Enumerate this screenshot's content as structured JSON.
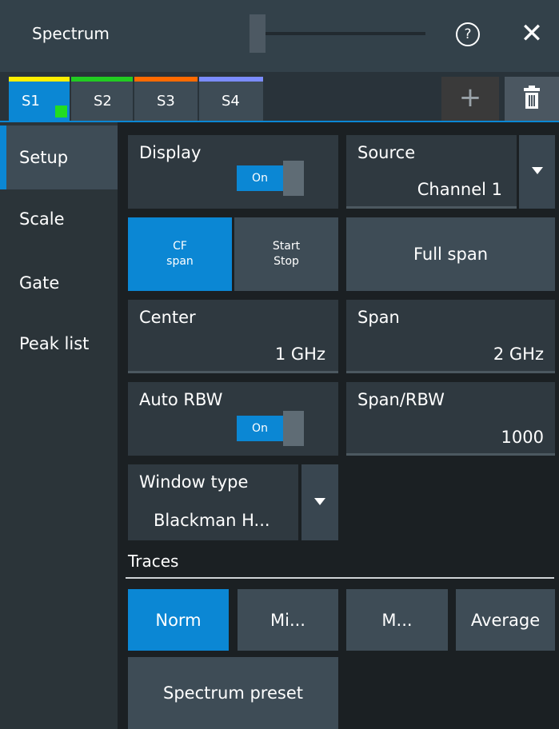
{
  "title": "Spectrum",
  "header": {
    "help_icon": "?",
    "close_icon": "✕"
  },
  "tabs": [
    {
      "label": "S1",
      "color": "#ffee00",
      "active": true
    },
    {
      "label": "S2",
      "color": "#22cc22"
    },
    {
      "label": "S3",
      "color": "#ff6a00"
    },
    {
      "label": "S4",
      "color": "#7b8cff"
    }
  ],
  "toolbar": {
    "add_label": "+"
  },
  "nav": [
    {
      "label": "Setup"
    },
    {
      "label": "Scale"
    },
    {
      "label": "Gate"
    },
    {
      "label": "Peak list"
    }
  ],
  "display": {
    "label": "Display",
    "toggle": "On"
  },
  "source": {
    "label": "Source",
    "value": "Channel 1"
  },
  "span_mode": {
    "cf_line1": "CF",
    "cf_line2": "span",
    "ss_line1": "Start",
    "ss_line2": "Stop"
  },
  "full_span": {
    "label": "Full span"
  },
  "center": {
    "label": "Center",
    "value": "1 GHz"
  },
  "span": {
    "label": "Span",
    "value": "2 GHz"
  },
  "auto_rbw": {
    "label": "Auto RBW",
    "toggle": "On"
  },
  "span_rbw": {
    "label": "Span/RBW",
    "value": "1000"
  },
  "window_type": {
    "label": "Window type",
    "value": "Blackman H..."
  },
  "traces": {
    "section_label": "Traces",
    "buttons": [
      "Norm",
      "Mi...",
      "M...",
      "Average"
    ]
  },
  "preset": {
    "label": "Spectrum preset"
  },
  "colors": {
    "accent": "#0b87d4",
    "panel": "#2f3940",
    "button": "#3e4c56"
  }
}
